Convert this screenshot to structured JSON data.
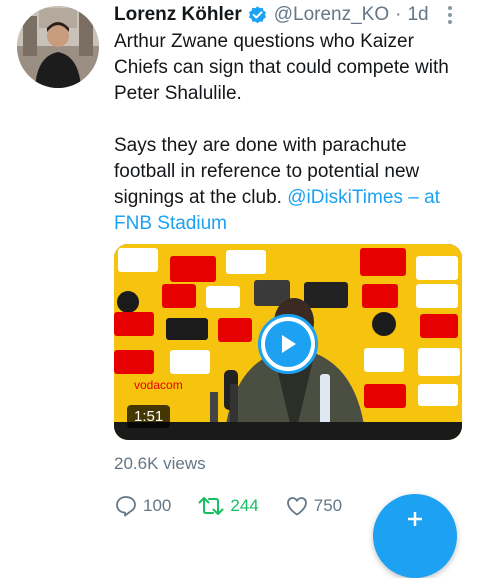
{
  "tweet": {
    "author_name": "Lorenz Köhler",
    "handle": "@Lorenz_KO",
    "separator": "·",
    "time": "1d",
    "text_para1": "Arthur Zwane questions who Kaizer Chiefs can sign that could compete with Peter Shalulile.",
    "text_para2_prefix": "Says they are done with parachute football in reference to potential new signings at the club.",
    "mention": "@iDiskiTimes",
    "location_link": "– at FNB Stadium"
  },
  "video": {
    "duration": "1:51",
    "sponsor_text": "vodacom"
  },
  "stats": {
    "views": "20.6K views",
    "replies": "100",
    "retweets": "244",
    "likes": "750"
  },
  "colors": {
    "accent": "#1da1f2",
    "retweet": "#17bf63",
    "muted": "#657786",
    "backdrop_yellow": "#f6c40f",
    "vodacom_red": "#e60000"
  }
}
